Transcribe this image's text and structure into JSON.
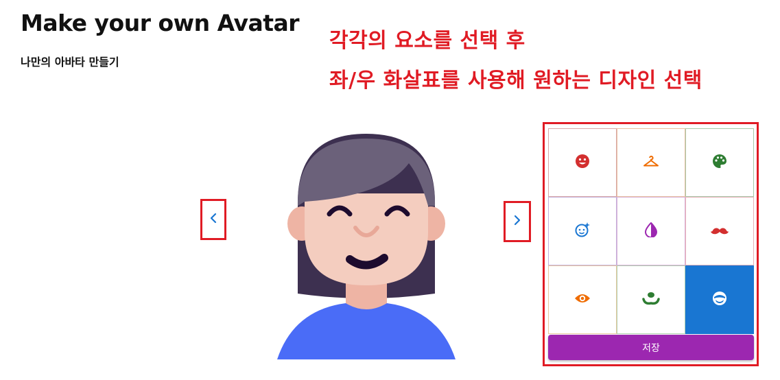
{
  "header": {
    "title": "Make your own Avatar",
    "subtitle": "나만의 아바타 만들기"
  },
  "instructions": {
    "line1": "각각의 요소를 선택 후",
    "line2": "좌/우 화살표를 사용해 원하는 디자인 선택"
  },
  "navigation": {
    "prev_icon": "chevron-left-icon",
    "next_icon": "chevron-right-icon"
  },
  "options": [
    {
      "icon": "face-smile-icon",
      "color": "#d32f2f"
    },
    {
      "icon": "hanger-icon",
      "color": "#ef6c00"
    },
    {
      "icon": "palette-icon",
      "color": "#2e7d32"
    },
    {
      "icon": "face-sparkle-icon",
      "color": "#1976d2"
    },
    {
      "icon": "tone-drop-icon",
      "color": "#9c27b0"
    },
    {
      "icon": "mustache-icon",
      "color": "#d32f2f"
    },
    {
      "icon": "eye-icon",
      "color": "#ef6c00"
    },
    {
      "icon": "nose-mouth-icon",
      "color": "#2e7d32"
    },
    {
      "icon": "mask-face-icon",
      "color": "#ffffff",
      "selected": true
    }
  ],
  "save_label": "저장",
  "colors": {
    "accent_red": "#e01b24",
    "primary_blue": "#1976d2",
    "save_purple": "#9c27b0",
    "hair": "#6b617a",
    "skin": "#f4cdbf",
    "shirt": "#4a6cf7"
  }
}
